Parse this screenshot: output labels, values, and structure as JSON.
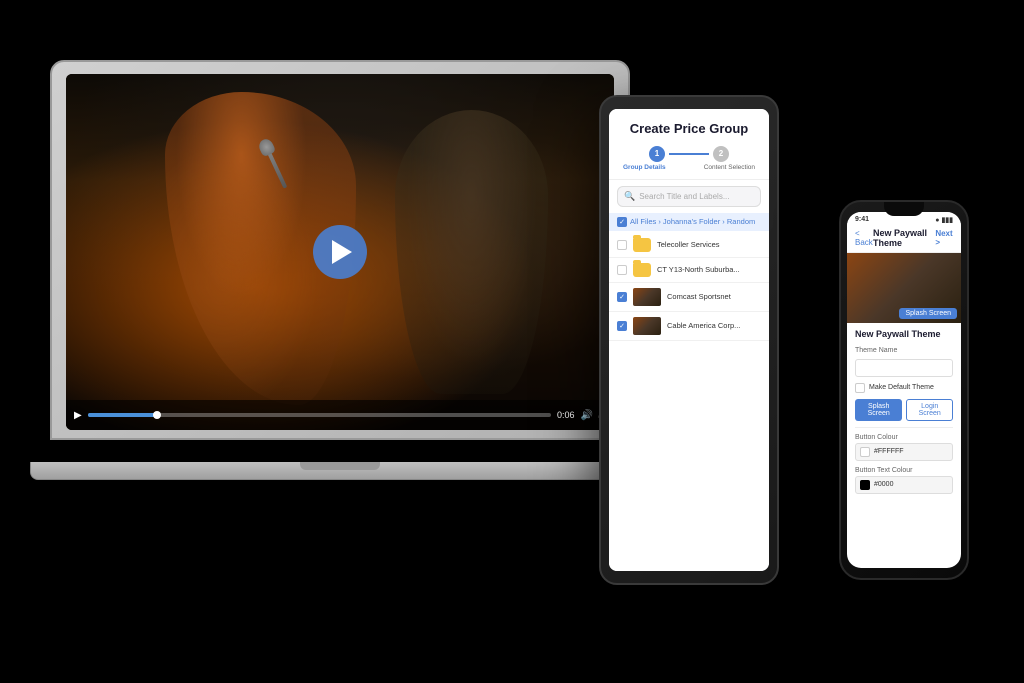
{
  "scene": {
    "bg": "#000000"
  },
  "laptop": {
    "video": {
      "time": "0:06",
      "progress_pct": 15,
      "play_label": "▶"
    }
  },
  "tablet": {
    "title": "Create Price Group",
    "step1_label": "Group Details",
    "step2_label": "Content Selection",
    "search_placeholder": "Search Title and Labels...",
    "breadcrumb": "All Files › Johanna's Folder › Random",
    "files": [
      {
        "name": "Telecoller Services",
        "type": "folder",
        "checked": false
      },
      {
        "name": "CT Y13-North Suburba...",
        "type": "folder",
        "checked": false
      },
      {
        "name": "Comcast Sportsnet",
        "type": "video",
        "checked": true
      },
      {
        "name": "Cable America Corp...",
        "type": "video",
        "checked": true
      }
    ]
  },
  "phone": {
    "status_time": "9:41",
    "status_signal": "●●●",
    "status_battery": "100%",
    "back_label": "< Back",
    "header_title": "New Paywall Theme",
    "next_label": "Next >",
    "form_title": "New Paywall Theme",
    "fields": [
      {
        "label": "Theme Name",
        "value": ""
      },
      {
        "label": "Make Default Theme",
        "type": "checkbox"
      }
    ],
    "btn_splash": "Splash Screen",
    "btn_login": "Login Screen",
    "button_color_label": "Button Colour",
    "button_color_value": "#FFFFFF",
    "button_color_swatch": "#FFFFFF",
    "btn_text_label": "Button Text Colour",
    "btn_text_value": "#0000",
    "btn_text_swatch": "#000000"
  }
}
